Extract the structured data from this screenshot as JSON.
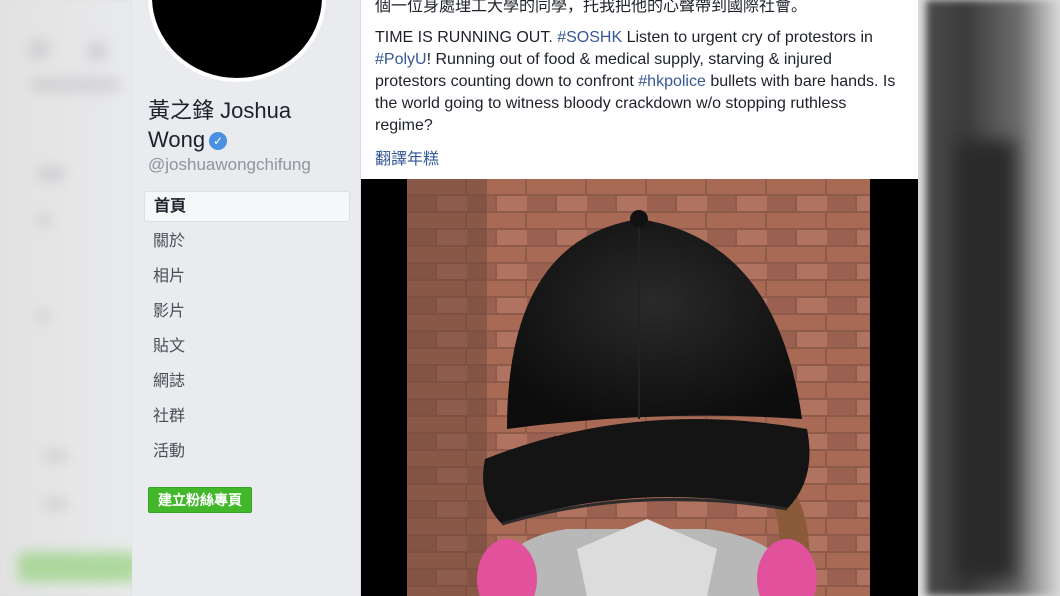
{
  "profile": {
    "name_line1": "黃之鋒 Joshua",
    "name_line2": "Wong",
    "verified_icon": "verified-check-icon",
    "username": "@joshuawongchifung"
  },
  "nav": {
    "items": [
      {
        "label": "首頁",
        "active": true
      },
      {
        "label": "關於"
      },
      {
        "label": "相片"
      },
      {
        "label": "影片"
      },
      {
        "label": "貼文"
      },
      {
        "label": "網誌"
      },
      {
        "label": "社群"
      },
      {
        "label": "活動"
      }
    ],
    "create_page_button": "建立粉絲專頁"
  },
  "post": {
    "cn_line": "個一位身處理工大學的同學，托我把他的心聲帶到國際社會。",
    "en_part1": "TIME IS RUNNING OUT. ",
    "hashtag1": "#SOSHK",
    "en_part2": " Listen to urgent cry of protestors in ",
    "hashtag2": "#PolyU",
    "en_part3": "! Running out of food & medical supply, starving & injured protestors counting down to confront ",
    "hashtag3": "#hkpolice",
    "en_part4": " bullets with bare hands. Is the world going to witness bloody crackdown w/o stopping ruthless regime?",
    "translate_link": "翻譯年糕"
  },
  "colors": {
    "link": "#365899",
    "create_button": "#42b72a",
    "sidebar_bg": "#e9ebee"
  }
}
